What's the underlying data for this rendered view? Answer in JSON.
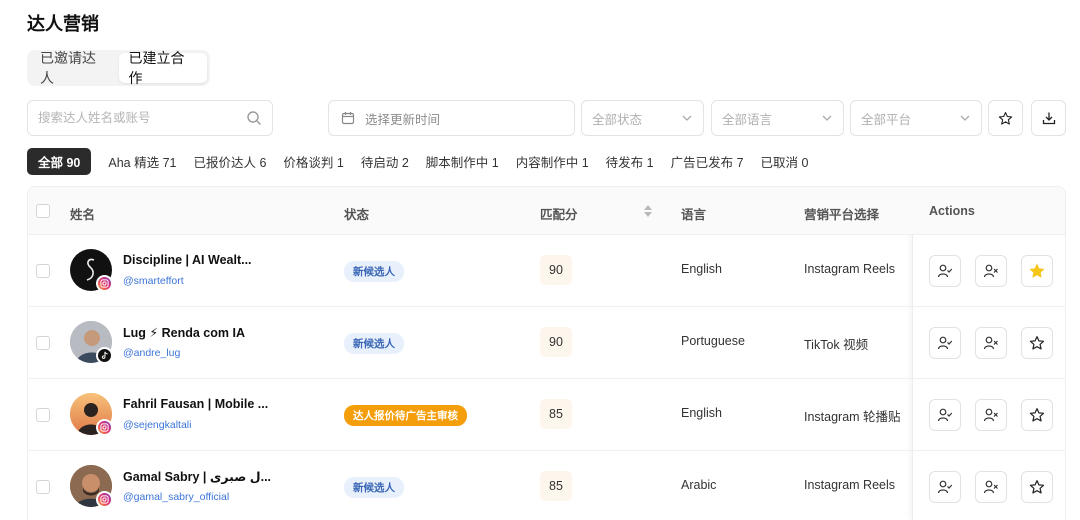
{
  "page": {
    "title": "达人营销"
  },
  "tabs": [
    {
      "label": "已邀请达人"
    },
    {
      "label": "已建立合作"
    }
  ],
  "toolbar": {
    "search_placeholder": "搜索达人姓名或账号",
    "date_placeholder": "选择更新时间",
    "status_select": "全部状态",
    "language_select": "全部语言",
    "platform_select": "全部平台"
  },
  "filters": [
    {
      "label": "全部 90"
    },
    {
      "label": "Aha 精选 71"
    },
    {
      "label": "已报价达人 6"
    },
    {
      "label": "价格谈判 1"
    },
    {
      "label": "待启动 2"
    },
    {
      "label": "脚本制作中 1"
    },
    {
      "label": "内容制作中 1"
    },
    {
      "label": "待发布 1"
    },
    {
      "label": "广告已发布 7"
    },
    {
      "label": "已取消 0"
    }
  ],
  "table": {
    "columns": {
      "name": "姓名",
      "status": "状态",
      "score": "匹配分",
      "language": "语言",
      "platform": "营销平台选择",
      "actions": "Actions"
    },
    "rows": [
      {
        "name": "Discipline | AI Wealt...",
        "handle": "@smarteffort",
        "status": "新候选人",
        "status_color": "blue",
        "score": "90",
        "language": "English",
        "platform": "Instagram Reels",
        "social": "instagram-icon",
        "starred": true
      },
      {
        "name": "Lug ⚡ Renda com IA",
        "handle": "@andre_lug",
        "status": "新候选人",
        "status_color": "blue",
        "score": "90",
        "language": "Portuguese",
        "platform": "TikTok 视频",
        "social": "tiktok-icon",
        "starred": false
      },
      {
        "name": "Fahril Fausan | Mobile ...",
        "handle": "@sejengkaltali",
        "status": "达人报价待广告主审核",
        "status_color": "orange",
        "score": "85",
        "language": "English",
        "platform": "Instagram 轮播贴",
        "social": "instagram-icon",
        "starred": false
      },
      {
        "name": "Gamal Sabry | ل صبرى...",
        "handle": "@gamal_sabry_official",
        "status": "新候选人",
        "status_color": "blue",
        "score": "85",
        "language": "Arabic",
        "platform": "Instagram Reels",
        "social": "instagram-icon",
        "starred": false
      }
    ]
  },
  "colors": {
    "accent_blue": "#3b74d8",
    "star_active": "#f5c518",
    "orange_status": "#f59e0b"
  }
}
